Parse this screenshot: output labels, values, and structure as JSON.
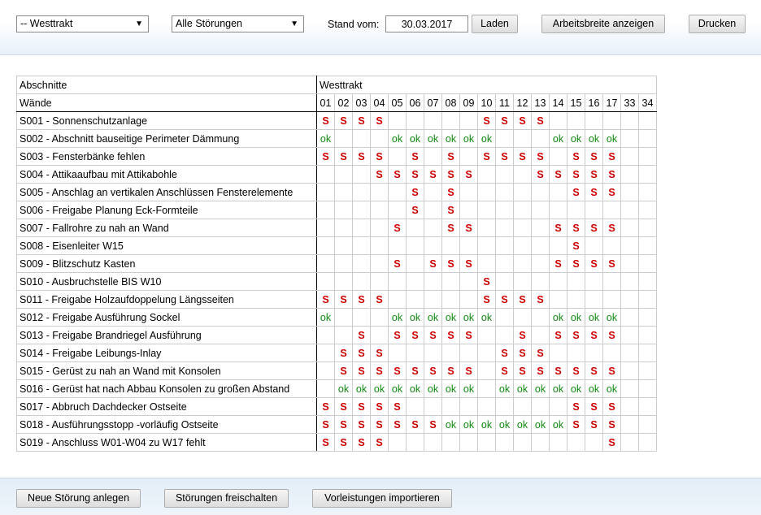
{
  "toolbar": {
    "section_select": "-- Westtrakt",
    "filter_select": "Alle Störungen",
    "stand_label": "Stand vom:",
    "date_value": "30.03.2017",
    "load_button": "Laden",
    "workwidth_button": "Arbeitsbreite anzeigen",
    "print_button": "Drucken"
  },
  "table": {
    "group_header": "Abschnitte",
    "wall_header": "Wände",
    "section_name": "Westtrakt",
    "columns": [
      "01",
      "02",
      "03",
      "04",
      "05",
      "06",
      "07",
      "08",
      "09",
      "10",
      "11",
      "12",
      "13",
      "14",
      "15",
      "16",
      "17",
      "33",
      "34"
    ],
    "rows": [
      {
        "label": "S001 - Sonnenschutzanlage",
        "cells": [
          "S",
          "S",
          "S",
          "S",
          "",
          "",
          "",
          "",
          "",
          "S",
          "S",
          "S",
          "S",
          "",
          "",
          "",
          "",
          "",
          ""
        ]
      },
      {
        "label": "S002 - Abschnitt bauseitige Perimeter Dämmung",
        "cells": [
          "ok",
          "",
          "",
          "",
          "ok",
          "ok",
          "ok",
          "ok",
          "ok",
          "ok",
          "",
          "",
          "",
          "ok",
          "ok",
          "ok",
          "ok",
          "",
          ""
        ]
      },
      {
        "label": "S003 - Fensterbänke fehlen",
        "cells": [
          "S",
          "S",
          "S",
          "S",
          "",
          "S",
          "",
          "S",
          "",
          "S",
          "S",
          "S",
          "S",
          "",
          "S",
          "S",
          "S",
          "",
          ""
        ]
      },
      {
        "label": "S004 - Attikaaufbau mit Attikabohle",
        "cells": [
          "",
          "",
          "",
          "S",
          "S",
          "S",
          "S",
          "S",
          "S",
          "",
          "",
          "",
          "S",
          "S",
          "S",
          "S",
          "S",
          "",
          ""
        ]
      },
      {
        "label": "S005 - Anschlag an vertikalen Anschlüssen Fensterelemente",
        "cells": [
          "",
          "",
          "",
          "",
          "",
          "S",
          "",
          "S",
          "",
          "",
          "",
          "",
          "",
          "",
          "S",
          "S",
          "S",
          "",
          ""
        ]
      },
      {
        "label": "S006 - Freigabe Planung Eck-Formteile",
        "cells": [
          "",
          "",
          "",
          "",
          "",
          "S",
          "",
          "S",
          "",
          "",
          "",
          "",
          "",
          "",
          "",
          "",
          "",
          "",
          ""
        ]
      },
      {
        "label": "S007 - Fallrohre zu nah an Wand",
        "cells": [
          "",
          "",
          "",
          "",
          "S",
          "",
          "",
          "S",
          "S",
          "",
          "",
          "",
          "",
          "S",
          "S",
          "S",
          "S",
          "",
          ""
        ]
      },
      {
        "label": "S008 - Eisenleiter W15",
        "cells": [
          "",
          "",
          "",
          "",
          "",
          "",
          "",
          "",
          "",
          "",
          "",
          "",
          "",
          "",
          "S",
          "",
          "",
          "",
          ""
        ]
      },
      {
        "label": "S009 - Blitzschutz Kasten",
        "cells": [
          "",
          "",
          "",
          "",
          "S",
          "",
          "S",
          "S",
          "S",
          "",
          "",
          "",
          "",
          "S",
          "S",
          "S",
          "S",
          "",
          ""
        ]
      },
      {
        "label": "S010 - Ausbruchstelle BIS W10",
        "cells": [
          "",
          "",
          "",
          "",
          "",
          "",
          "",
          "",
          "",
          "S",
          "",
          "",
          "",
          "",
          "",
          "",
          "",
          "",
          ""
        ]
      },
      {
        "label": "S011 - Freigabe Holzaufdoppelung Längsseiten",
        "cells": [
          "S",
          "S",
          "S",
          "S",
          "",
          "",
          "",
          "",
          "",
          "S",
          "S",
          "S",
          "S",
          "",
          "",
          "",
          "",
          "",
          ""
        ]
      },
      {
        "label": "S012 - Freigabe Ausführung Sockel",
        "cells": [
          "ok",
          "",
          "",
          "",
          "ok",
          "ok",
          "ok",
          "ok",
          "ok",
          "ok",
          "",
          "",
          "",
          "ok",
          "ok",
          "ok",
          "ok",
          "",
          ""
        ]
      },
      {
        "label": "S013 - Freigabe Brandriegel Ausführung",
        "cells": [
          "",
          "",
          "S",
          "",
          "S",
          "S",
          "S",
          "S",
          "S",
          "",
          "",
          "S",
          "",
          "S",
          "S",
          "S",
          "S",
          "",
          ""
        ]
      },
      {
        "label": "S014 - Freigabe Leibungs-Inlay",
        "cells": [
          "",
          "S",
          "S",
          "S",
          "",
          "",
          "",
          "",
          "",
          "",
          "S",
          "S",
          "S",
          "",
          "",
          "",
          "",
          "",
          ""
        ]
      },
      {
        "label": "S015 - Gerüst zu nah an Wand mit Konsolen",
        "cells": [
          "",
          "S",
          "S",
          "S",
          "S",
          "S",
          "S",
          "S",
          "S",
          "",
          "S",
          "S",
          "S",
          "S",
          "S",
          "S",
          "S",
          "",
          ""
        ]
      },
      {
        "label": "S016 - Gerüst hat nach Abbau Konsolen zu großen Abstand",
        "cells": [
          "",
          "ok",
          "ok",
          "ok",
          "ok",
          "ok",
          "ok",
          "ok",
          "ok",
          "",
          "ok",
          "ok",
          "ok",
          "ok",
          "ok",
          "ok",
          "ok",
          "",
          ""
        ]
      },
      {
        "label": "S017 - Abbruch Dachdecker Ostseite",
        "cells": [
          "S",
          "S",
          "S",
          "S",
          "S",
          "",
          "",
          "",
          "",
          "",
          "",
          "",
          "",
          "",
          "S",
          "S",
          "S",
          "",
          ""
        ]
      },
      {
        "label": "S018 - Ausführungsstopp -vorläufig Ostseite",
        "cells": [
          "S",
          "S",
          "S",
          "S",
          "S",
          "S",
          "S",
          "ok",
          "ok",
          "ok",
          "ok",
          "ok",
          "ok",
          "ok",
          "S",
          "S",
          "S",
          "",
          ""
        ]
      },
      {
        "label": "S019 - Anschluss W01-W04 zu W17 fehlt",
        "cells": [
          "S",
          "S",
          "S",
          "S",
          "",
          "",
          "",
          "",
          "",
          "",
          "",
          "",
          "",
          "",
          "",
          "",
          "S",
          "",
          ""
        ]
      }
    ]
  },
  "footer": {
    "new_button": "Neue Störung anlegen",
    "release_button": "Störungen freischalten",
    "import_button": "Vorleistungen importieren"
  }
}
